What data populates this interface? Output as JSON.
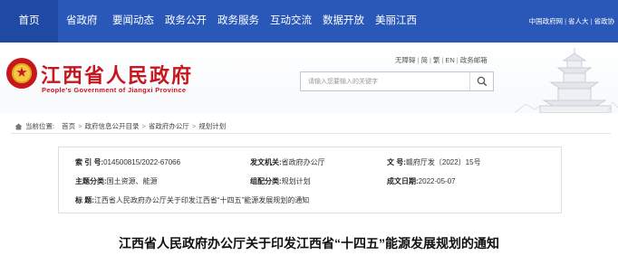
{
  "nav": {
    "items": [
      "首页",
      "省政府",
      "要闻动态",
      "政务公开",
      "政务服务",
      "互动交流",
      "数据开放",
      "美丽江西"
    ],
    "right_links": [
      "中国政府网",
      "省人大",
      "省政协"
    ],
    "color": "#2a58b8"
  },
  "header": {
    "title": "江西省人民政府",
    "subtitle": "People's Government of Jiangxi Province",
    "util_links": [
      "无障碍",
      "简",
      "繁",
      "EN",
      "政务邮箱"
    ],
    "search_placeholder": "请输入您要输入的关键字",
    "title_color": "#c8161d"
  },
  "breadcrumb": {
    "label": "当前位置:",
    "items": [
      "首页",
      "政府信息公开目录",
      "省政府办公厅",
      "规划计划"
    ]
  },
  "info": {
    "index_label": "索  引  号:",
    "index_value": "014500815/2022-67066",
    "issuer_label": "发文机关:",
    "issuer_value": "省政府办公厅",
    "docno_label": "文      号:",
    "docno_value": "赣府厅发〔2022〕15号",
    "topic_label": "主题分类:",
    "topic_value": "国土资源、能源",
    "category_label": "组配分类:",
    "category_value": "规划计划",
    "date_label": "成文日期:",
    "date_value": "2022-05-07",
    "title_label": "标      题:",
    "title_value": "江西省人民政府办公厅关于印发江西省“十四五”能源发展规划的通知"
  },
  "article": {
    "title": "江西省人民政府办公厅关于印发江西省“十四五”能源发展规划的通知"
  }
}
